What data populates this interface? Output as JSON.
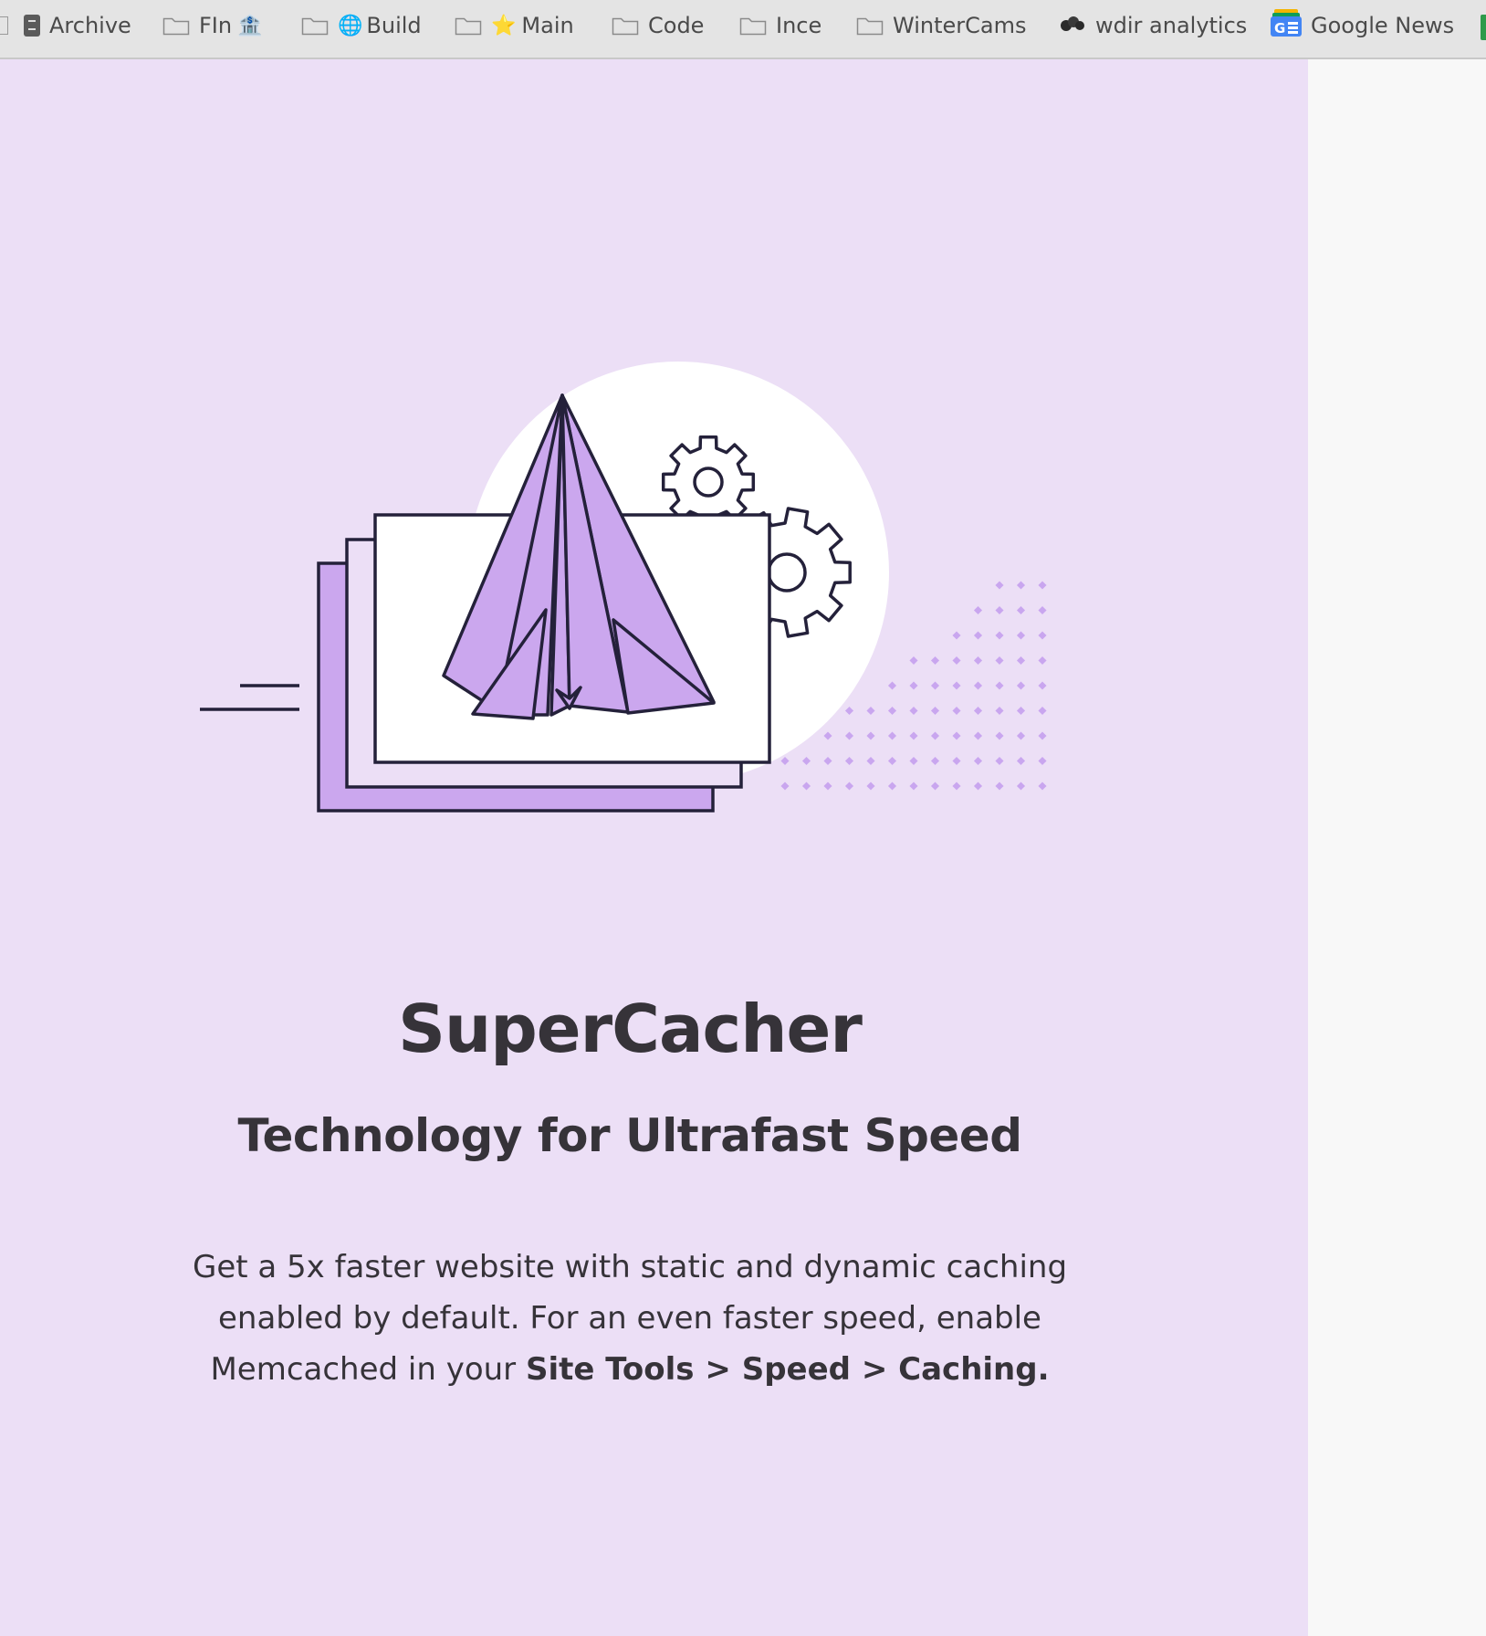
{
  "bookmarks": [
    {
      "label": "Archive",
      "icon": "file-cabinet-icon"
    },
    {
      "label": "FIn",
      "icon": "folder-icon",
      "emoji": "🏦"
    },
    {
      "label": "Build",
      "icon": "folder-icon",
      "emoji_prefix": "🌐"
    },
    {
      "label": "Main",
      "icon": "folder-icon",
      "emoji_prefix": "⭐"
    },
    {
      "label": "Code",
      "icon": "folder-icon"
    },
    {
      "label": "Ince",
      "icon": "folder-icon"
    },
    {
      "label": "WinterCams",
      "icon": "folder-icon"
    },
    {
      "label": "wdir analytics",
      "icon": "analytics-logo-icon"
    },
    {
      "label": "Google News",
      "icon": "google-news-icon"
    }
  ],
  "hero": {
    "title": "SuperCacher",
    "subtitle": "Technology for Ultrafast Speed",
    "description_plain": "Get a 5x faster website with static and dynamic caching enabled by default. For an even faster speed, enable Memcached in your ",
    "description_bold": "Site Tools > Speed > Caching."
  },
  "colors": {
    "panel_bg": "#ecdff6",
    "accent_purple": "#cba7ee",
    "outline": "#24213a",
    "text": "#363339"
  }
}
